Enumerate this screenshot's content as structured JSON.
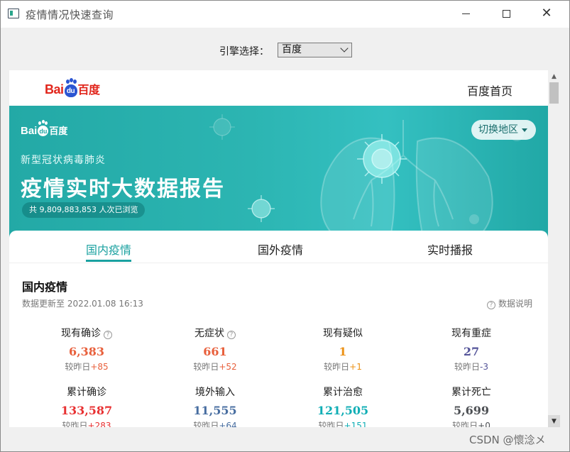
{
  "window": {
    "title": "疫情情况快速查询",
    "minimize_glyph": "",
    "maximize_glyph": "",
    "close_glyph": "✕"
  },
  "engine": {
    "label": "引擎选择：",
    "selected": "百度"
  },
  "page": {
    "logo": {
      "bai": "Bai",
      "du": "du",
      "cn": "百度"
    },
    "home_link": "百度首页",
    "hero": {
      "logo": {
        "bai": "Bai",
        "du": "du",
        "cn": "百度"
      },
      "subtitle": "新型冠状病毒肺炎",
      "title": "疫情实时大数据报告",
      "views": "共 9,809,883,853 人次已浏览",
      "region_button": "切换地区"
    },
    "tabs": [
      {
        "label": "国内疫情",
        "active": true
      },
      {
        "label": "国外疫情",
        "active": false
      },
      {
        "label": "实时播报",
        "active": false
      }
    ],
    "section": {
      "title": "国内疫情",
      "update_time": "数据更新至 2022.01.08 16:13",
      "note": "数据说明"
    },
    "stats": [
      {
        "label": "现有确诊",
        "value": "6,383",
        "delta_prefix": "较昨日",
        "delta": "+85",
        "color": "#e8603c",
        "delta_color": "#e8603c",
        "info": true
      },
      {
        "label": "无症状",
        "value": "661",
        "delta_prefix": "较昨日",
        "delta": "+52",
        "color": "#e8603c",
        "delta_color": "#e8603c",
        "info": true
      },
      {
        "label": "现有疑似",
        "value": "1",
        "delta_prefix": "较昨日",
        "delta": "+1",
        "color": "#ec9217",
        "delta_color": "#ec9217",
        "info": false
      },
      {
        "label": "现有重症",
        "value": "27",
        "delta_prefix": "较昨日",
        "delta": "-3",
        "color": "#545499",
        "delta_color": "#545499",
        "info": false
      },
      {
        "label": "累计确诊",
        "value": "133,587",
        "delta_prefix": "较昨日",
        "delta": "+283",
        "color": "#e83132",
        "delta_color": "#e83132",
        "info": false
      },
      {
        "label": "境外输入",
        "value": "11,555",
        "delta_prefix": "较昨日",
        "delta": "+64",
        "color": "#476da0",
        "delta_color": "#476da0",
        "info": false
      },
      {
        "label": "累计治愈",
        "value": "121,505",
        "delta_prefix": "较昨日",
        "delta": "+151",
        "color": "#10aeb5",
        "delta_color": "#10aeb5",
        "info": false
      },
      {
        "label": "累计死亡",
        "value": "5,699",
        "delta_prefix": "较昨日",
        "delta": "+0",
        "color": "#4d5054",
        "delta_color": "#4d5054",
        "info": false
      }
    ]
  },
  "watermark": "CSDN @懷淰メ",
  "colors": {
    "accent": "#1aa1a0",
    "hero": "#2cb5b2"
  }
}
